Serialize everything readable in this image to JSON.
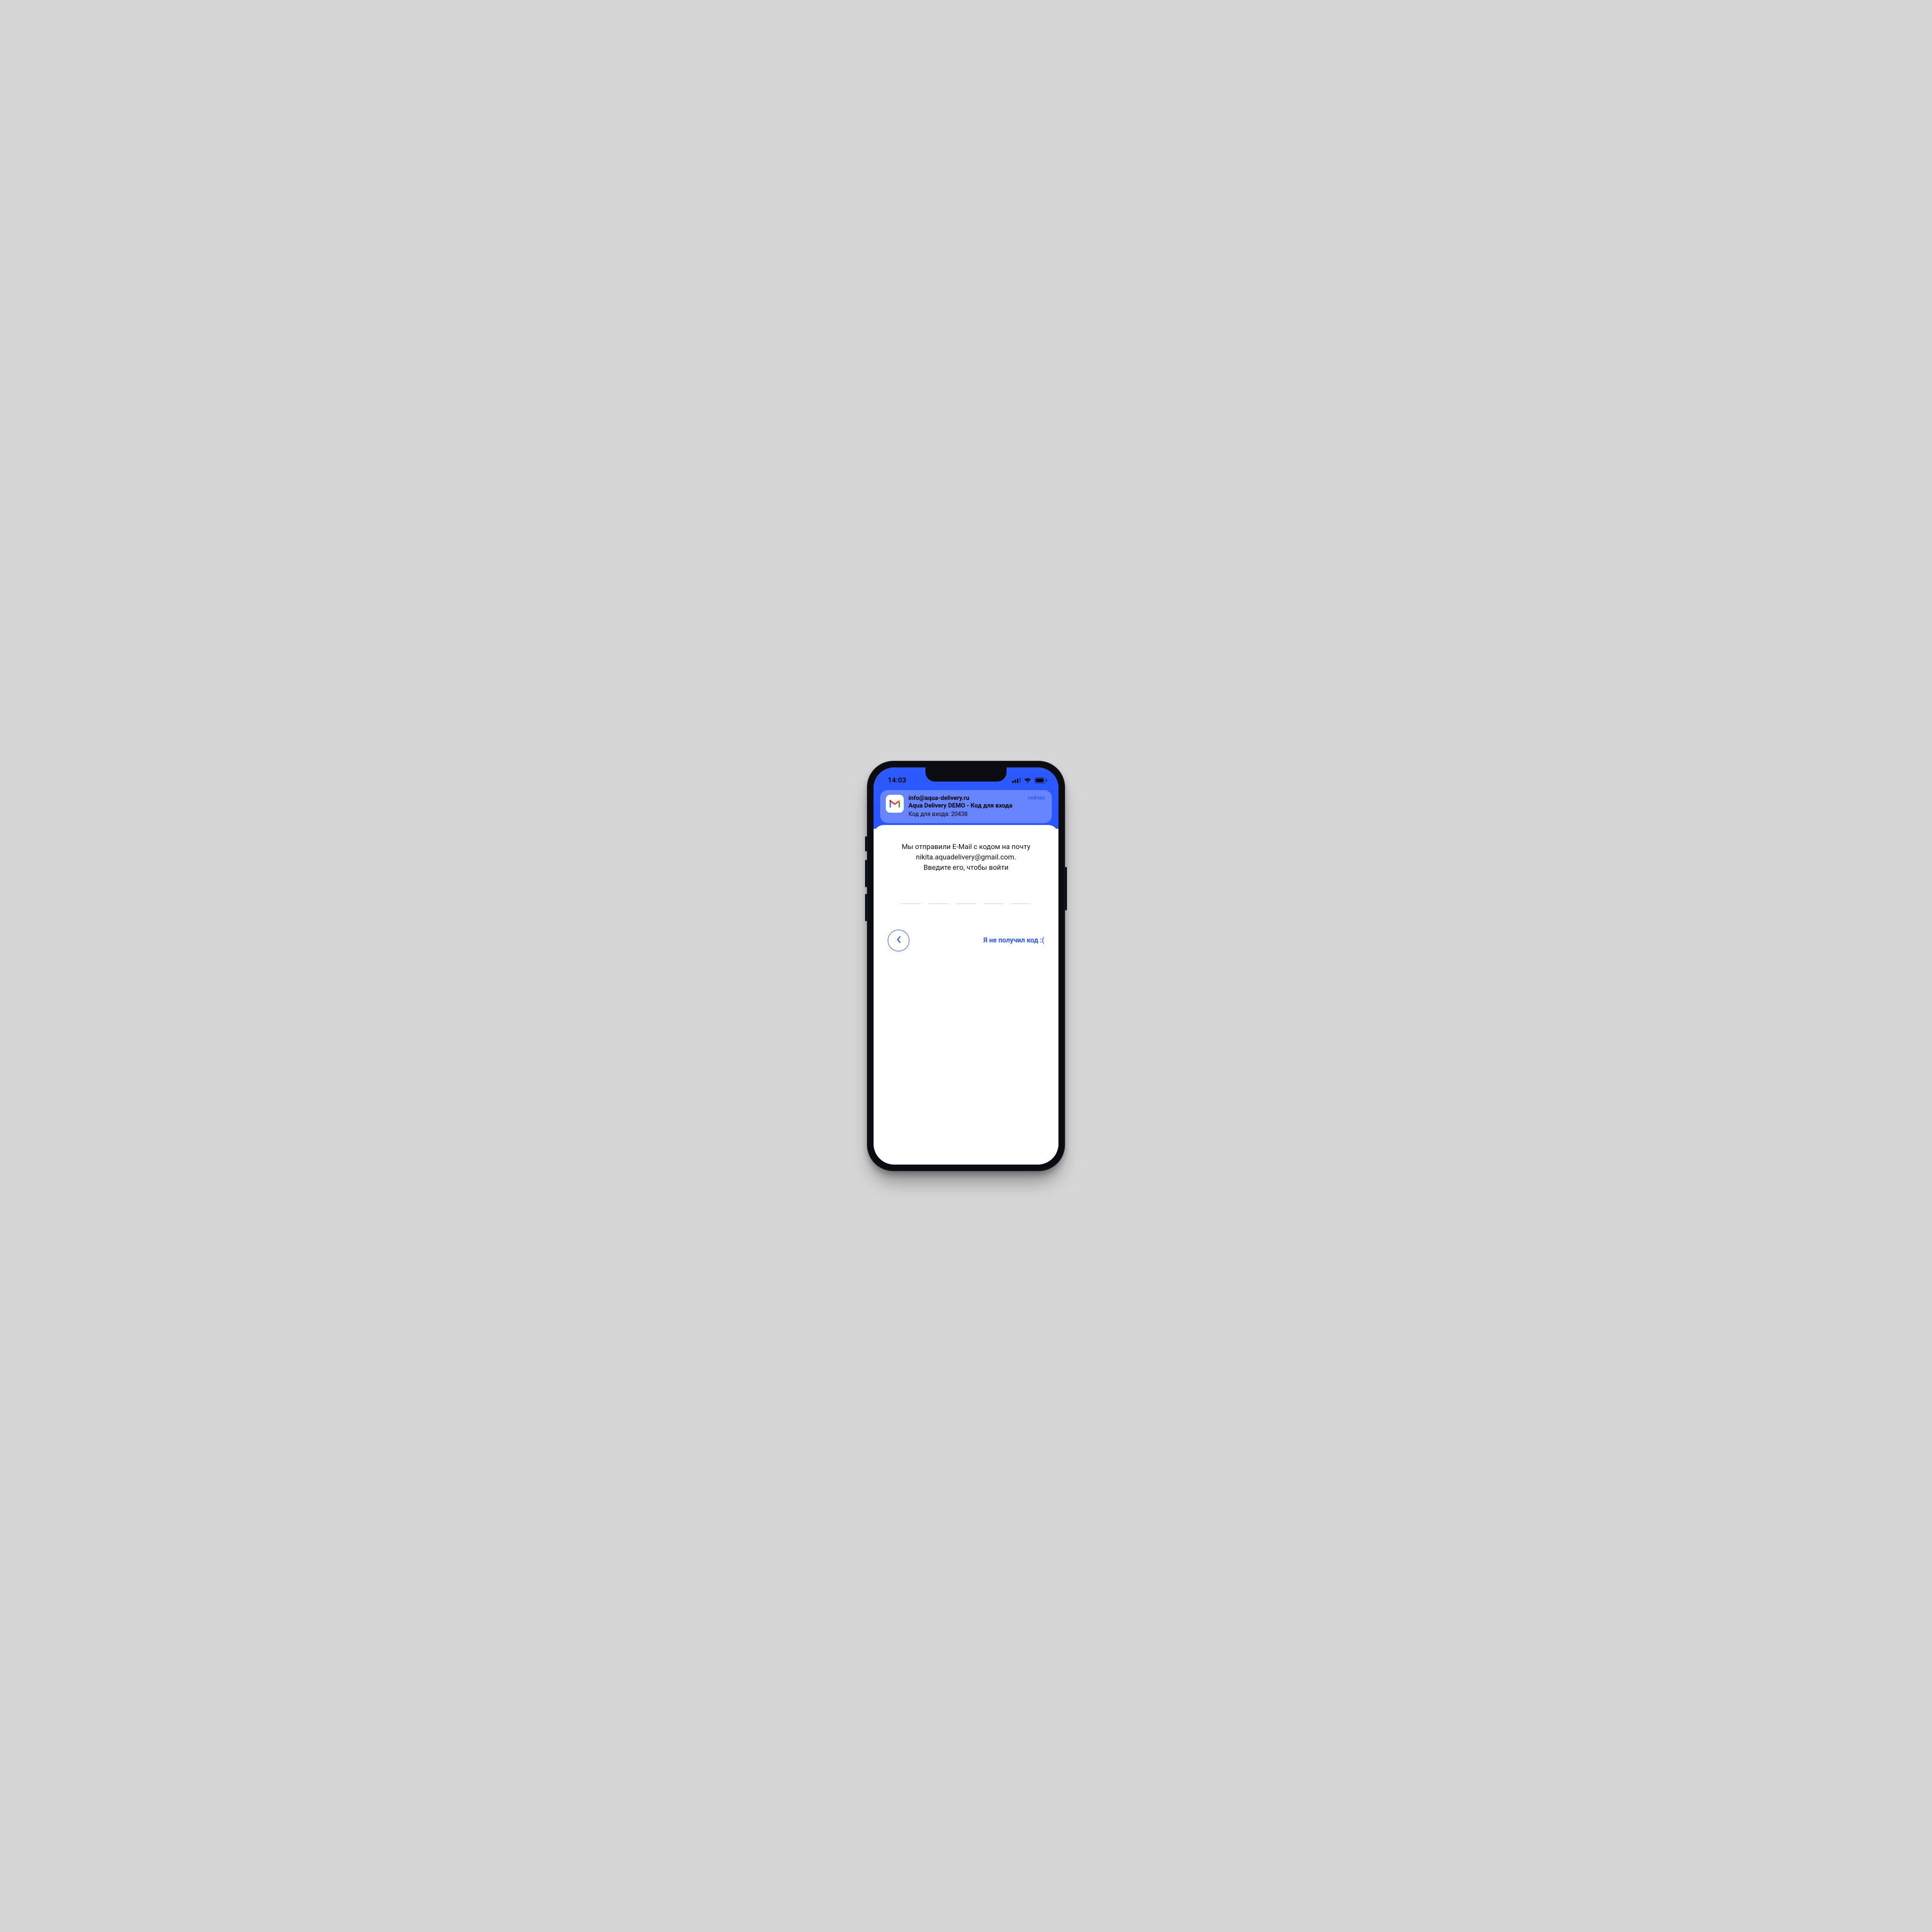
{
  "status": {
    "time": "14:03"
  },
  "notification": {
    "time_label": "сейчас",
    "sender": "info@aqua-delivery.ru",
    "subject": "Aqua Delivery DEMO - Код для входа",
    "preview": "Код для входа: 20438",
    "app_icon": "gmail-icon"
  },
  "main": {
    "instruction_line1": "Мы отправили E-Mail с кодом на почту",
    "instruction_line2": "nikita.aquadelivery@gmail.com.",
    "instruction_line3": "Введите его, чтобы войти",
    "code_length": 5,
    "no_code_label": "Я не получил код :("
  },
  "colors": {
    "accent": "#2a55ff",
    "background": "#d6d6d6"
  }
}
